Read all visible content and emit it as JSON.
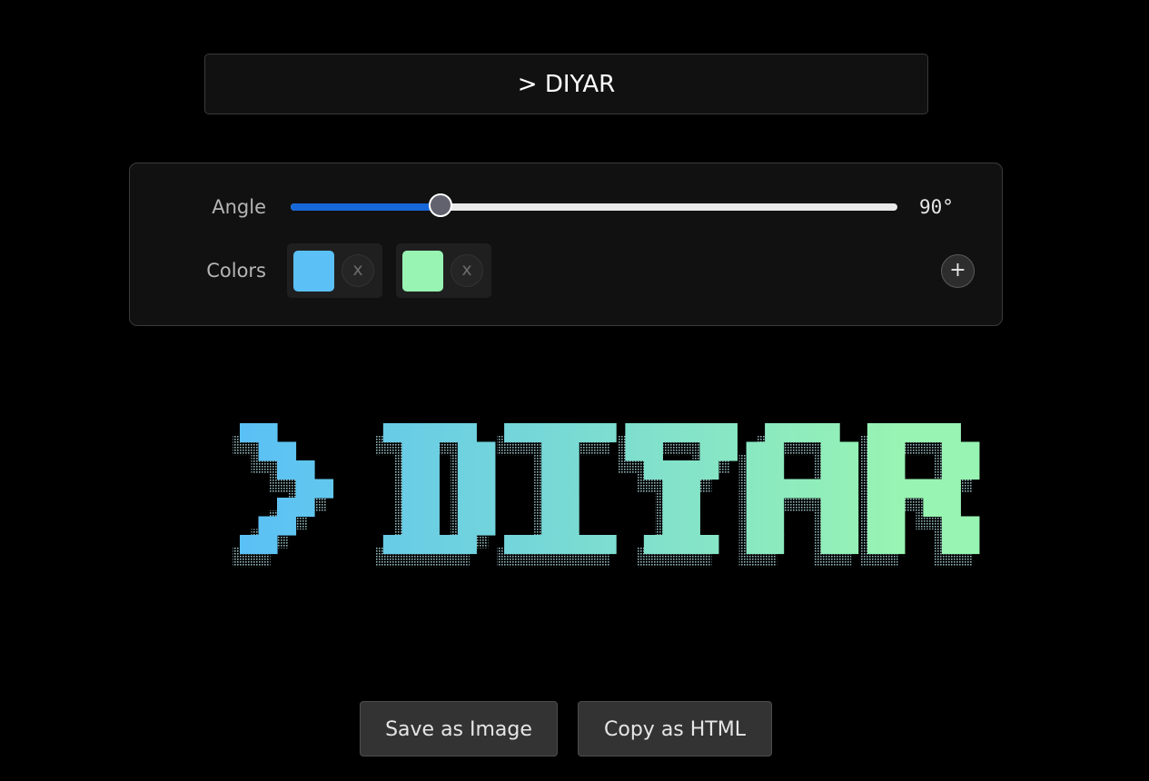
{
  "text_input": {
    "value": "> DIYAR"
  },
  "controls": {
    "angle_label": "Angle",
    "angle_min": 0,
    "angle_max": 360,
    "angle_value": 90,
    "angle_display": "90°",
    "colors_label": "Colors",
    "colors": [
      {
        "hex": "#5ac0f6",
        "remove_label": "x"
      },
      {
        "hex": "#98f4b2",
        "remove_label": "x"
      }
    ],
    "add_color_label": "+",
    "slider_accent": "#1668d8"
  },
  "preview": {
    "text": "> DIYAR",
    "gradient_from": "#5ac0f6",
    "gradient_to": "#98f4b2",
    "shadow_style": "dotted"
  },
  "actions": {
    "save_label": "Save as Image",
    "copy_label": "Copy as HTML"
  }
}
